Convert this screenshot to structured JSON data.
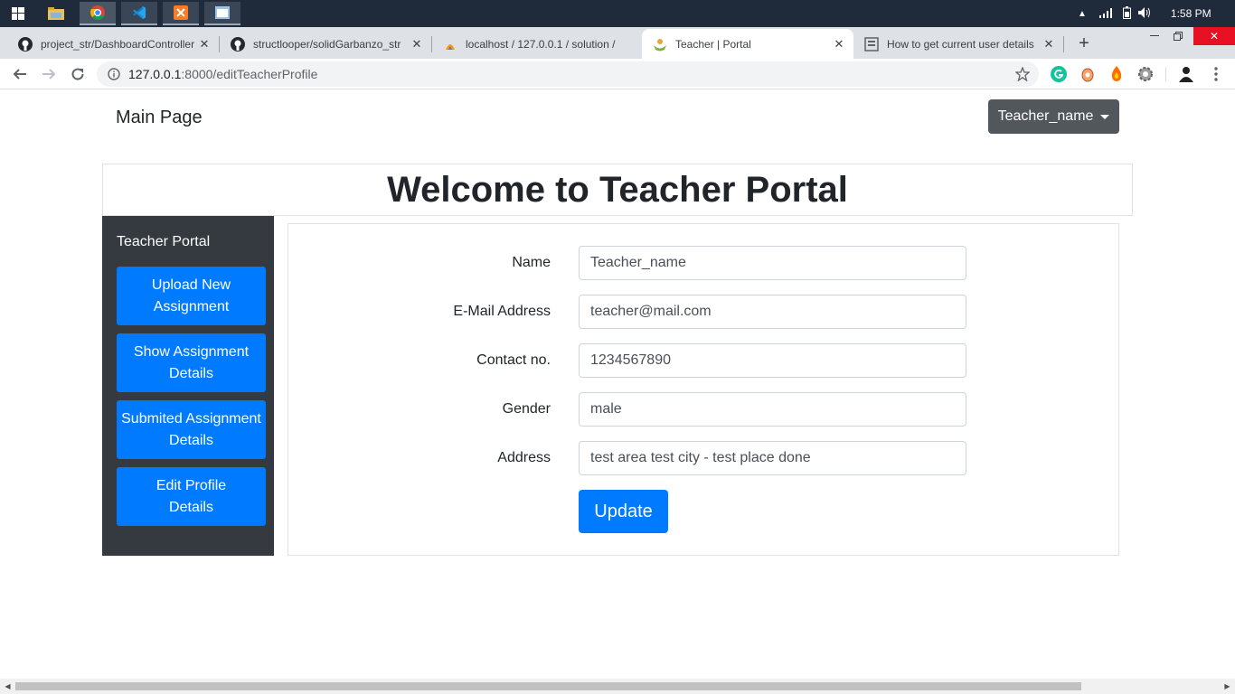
{
  "taskbar": {
    "clock": "1:58 PM"
  },
  "tabs": [
    {
      "title": "project_str/DashboardController",
      "icon": "github-icon"
    },
    {
      "title": "structlooper/solidGarbanzo_str",
      "icon": "github-icon"
    },
    {
      "title": "localhost / 127.0.0.1 / solution /",
      "icon": "phpmyadmin-icon"
    },
    {
      "title": "Teacher | Portal",
      "icon": "teacher-portal-icon"
    },
    {
      "title": "How to get current user details",
      "icon": "stackoverflow-icon"
    }
  ],
  "address": {
    "host": "127.0.0.1",
    "path": ":8000/editTeacherProfile"
  },
  "navbar": {
    "brand": "Main Page",
    "user_menu": "Teacher_name"
  },
  "hero": {
    "title": "Welcome to Teacher Portal"
  },
  "sidebar": {
    "title": "Teacher Portal",
    "items": [
      {
        "line1": "Upload New",
        "line2": "Assignment"
      },
      {
        "line1": "Show Assignment",
        "line2": "Details"
      },
      {
        "line1": "Submited Assignment",
        "line2": "Details"
      },
      {
        "line1": "Edit Profile",
        "line2": "Details"
      }
    ]
  },
  "form": {
    "fields": [
      {
        "label": "Name",
        "value": "Teacher_name"
      },
      {
        "label": "E-Mail Address",
        "value": "teacher@mail.com"
      },
      {
        "label": "Contact no.",
        "value": "1234567890"
      },
      {
        "label": "Gender",
        "value": "male"
      },
      {
        "label": "Address",
        "value": "test area test city - test place done"
      }
    ],
    "submit_label": "Update"
  },
  "colors": {
    "primary": "#007bff",
    "sidebar_bg": "#343a40",
    "dropdown_bg": "#52575c"
  }
}
